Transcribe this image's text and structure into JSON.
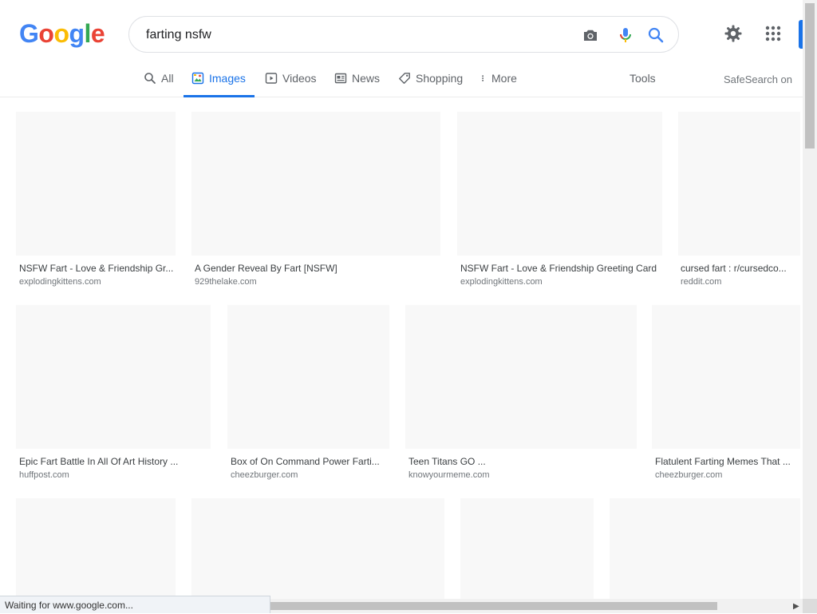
{
  "logo": {
    "letters": [
      "G",
      "o",
      "o",
      "g",
      "l",
      "e"
    ],
    "colors": [
      "#4285f4",
      "#ea4335",
      "#fbbc05",
      "#4285f4",
      "#34a853",
      "#ea4335"
    ]
  },
  "search": {
    "query": "farting nsfw"
  },
  "tabs": [
    {
      "label": "All",
      "icon": "search-icon"
    },
    {
      "label": "Images",
      "icon": "image-icon"
    },
    {
      "label": "Videos",
      "icon": "video-icon"
    },
    {
      "label": "News",
      "icon": "news-icon"
    },
    {
      "label": "Shopping",
      "icon": "tag-icon"
    },
    {
      "label": "More",
      "icon": "more-vert-icon"
    }
  ],
  "tools_label": "Tools",
  "safesearch_label": "SafeSearch on",
  "status_text": "Waiting for www.google.com...",
  "accent_color": "#1a73e8",
  "results": [
    {
      "title": "NSFW Fart - Love & Friendship Gr...",
      "source": "explodingkittens.com"
    },
    {
      "title": "A Gender Reveal By Fart [NSFW]",
      "source": "929thelake.com"
    },
    {
      "title": "NSFW Fart - Love & Friendship Greeting Card",
      "source": "explodingkittens.com"
    },
    {
      "title": "cursed fart : r/cursedco...",
      "source": "reddit.com"
    },
    {
      "title": "Epic Fart Battle In All Of Art History ...",
      "source": "huffpost.com"
    },
    {
      "title": "Box of On Command Power Farti...",
      "source": "cheezburger.com"
    },
    {
      "title": "Teen Titans GO ...",
      "source": "knowyourmeme.com"
    },
    {
      "title": "Flatulent Farting Memes That ...",
      "source": "cheezburger.com"
    },
    {
      "title": "",
      "source": ""
    },
    {
      "title": "",
      "source": ""
    },
    {
      "title": "",
      "source": ""
    },
    {
      "title": "",
      "source": ""
    }
  ]
}
